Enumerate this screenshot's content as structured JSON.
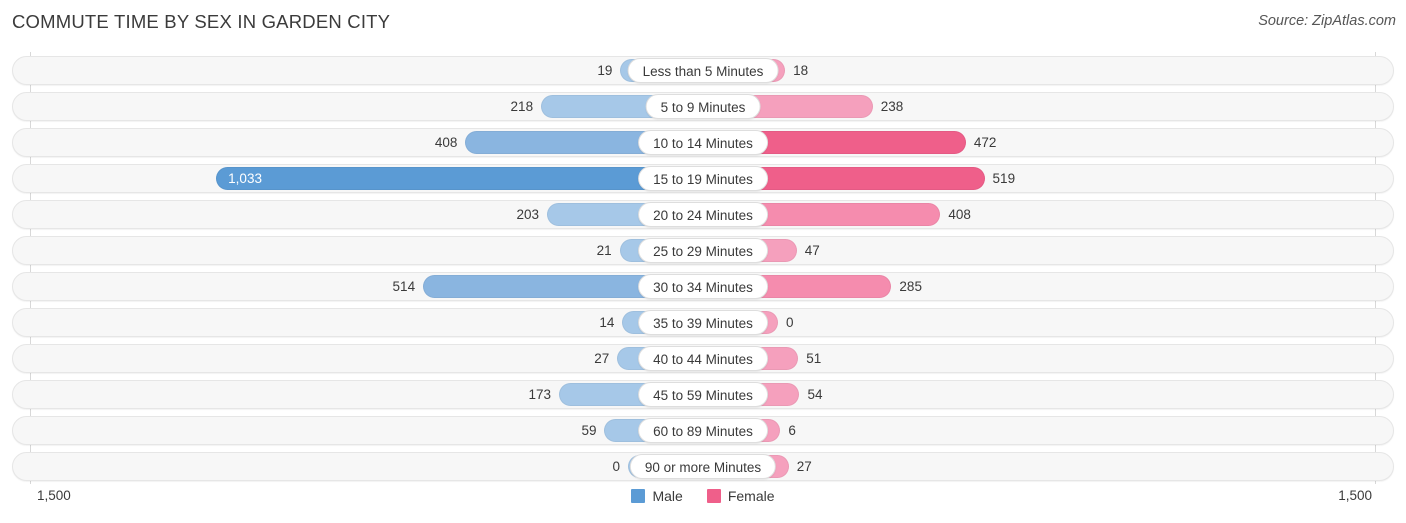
{
  "header": {
    "title": "COMMUTE TIME BY SEX IN GARDEN CITY",
    "source": "Source: ZipAtlas.com"
  },
  "axis": {
    "left_tick": "1,500",
    "right_tick": "1,500"
  },
  "legend": {
    "items": [
      {
        "label": "Male",
        "color": "#5b9bd5"
      },
      {
        "label": "Female",
        "color": "#ef5f8a"
      }
    ]
  },
  "colors": {
    "male_light": "#a6c8e8",
    "male_mid": "#8ab5e0",
    "male_strong": "#5b9bd5",
    "female_light": "#f5a0bd",
    "female_mid": "#f58cae",
    "female_strong": "#ef5f8a",
    "track": "#f7f7f7",
    "track_border": "#e6e6e6",
    "axis": "#d8d8d8",
    "text": "#3a3a3a"
  },
  "chart_data": {
    "type": "bar",
    "title": "COMMUTE TIME BY SEX IN GARDEN CITY",
    "subtype": "diverging-bidirectional",
    "xlabel": "",
    "ylabel": "",
    "xlim": [
      1500,
      1500
    ],
    "grid": false,
    "legend_position": "bottom-center",
    "categories": [
      "Less than 5 Minutes",
      "5 to 9 Minutes",
      "10 to 14 Minutes",
      "15 to 19 Minutes",
      "20 to 24 Minutes",
      "25 to 29 Minutes",
      "30 to 34 Minutes",
      "35 to 39 Minutes",
      "40 to 44 Minutes",
      "45 to 59 Minutes",
      "60 to 89 Minutes",
      "90 or more Minutes"
    ],
    "series": [
      {
        "name": "Male",
        "color": "#5b9bd5",
        "values": [
          19,
          218,
          408,
          1033,
          203,
          21,
          514,
          14,
          27,
          173,
          59,
          0
        ],
        "labels": [
          "19",
          "218",
          "408",
          "1,033",
          "203",
          "21",
          "514",
          "14",
          "27",
          "173",
          "59",
          "0"
        ]
      },
      {
        "name": "Female",
        "color": "#ef5f8a",
        "values": [
          18,
          238,
          472,
          519,
          408,
          47,
          285,
          0,
          51,
          54,
          6,
          27
        ],
        "labels": [
          "18",
          "238",
          "472",
          "519",
          "408",
          "47",
          "285",
          "0",
          "51",
          "54",
          "6",
          "27"
        ]
      }
    ]
  },
  "rows": [
    {
      "label": "Less than 5 Minutes",
      "male": "19",
      "female": "18"
    },
    {
      "label": "5 to 9 Minutes",
      "male": "218",
      "female": "238"
    },
    {
      "label": "10 to 14 Minutes",
      "male": "408",
      "female": "472"
    },
    {
      "label": "15 to 19 Minutes",
      "male": "1,033",
      "female": "519"
    },
    {
      "label": "20 to 24 Minutes",
      "male": "203",
      "female": "408"
    },
    {
      "label": "25 to 29 Minutes",
      "male": "21",
      "female": "47"
    },
    {
      "label": "30 to 34 Minutes",
      "male": "514",
      "female": "285"
    },
    {
      "label": "35 to 39 Minutes",
      "male": "14",
      "female": "0"
    },
    {
      "label": "40 to 44 Minutes",
      "male": "27",
      "female": "51"
    },
    {
      "label": "45 to 59 Minutes",
      "male": "173",
      "female": "54"
    },
    {
      "label": "60 to 89 Minutes",
      "male": "59",
      "female": "6"
    },
    {
      "label": "90 or more Minutes",
      "male": "0",
      "female": "27"
    }
  ]
}
